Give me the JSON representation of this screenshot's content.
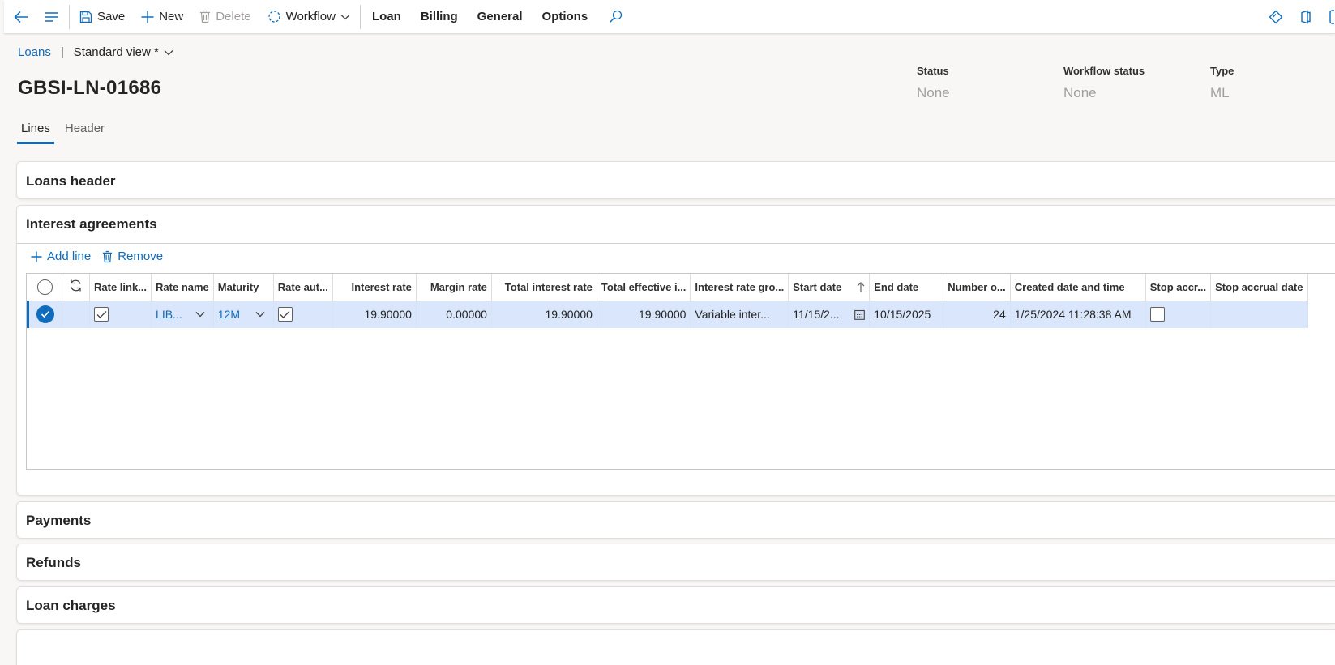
{
  "toolbar": {
    "save": "Save",
    "new": "New",
    "delete": "Delete",
    "workflow": "Workflow",
    "menus": [
      "Loan",
      "Billing",
      "General",
      "Options"
    ]
  },
  "breadcrumb": {
    "link": "Loans",
    "separator": "|",
    "view": "Standard view *"
  },
  "title": "GBSI-LN-01686",
  "summary": [
    {
      "label": "Status",
      "value": "None"
    },
    {
      "label": "Workflow status",
      "value": "None"
    },
    {
      "label": "Type",
      "value": "ML"
    }
  ],
  "tabs": [
    "Lines",
    "Header"
  ],
  "sections": {
    "loans_header": "Loans header",
    "interest_agreements": "Interest agreements",
    "payments": "Payments",
    "refunds": "Refunds",
    "loan_charges": "Loan charges"
  },
  "grid_actions": {
    "add_line": "Add line",
    "remove": "Remove"
  },
  "grid": {
    "columns": [
      "Rate link...",
      "Rate name",
      "Maturity",
      "Rate aut...",
      "Interest rate",
      "Margin rate",
      "Total interest rate",
      "Total effective i...",
      "Interest rate gro...",
      "Start date",
      "End date",
      "Number o...",
      "Created date and time",
      "Stop accr...",
      "Stop accrual date"
    ],
    "rows": [
      {
        "rate_linked": true,
        "rate_name": "LIB...",
        "maturity": "12M",
        "rate_auto": true,
        "interest_rate": "19.90000",
        "margin_rate": "0.00000",
        "total_interest_rate": "19.90000",
        "total_effective": "19.90000",
        "interest_rate_group": "Variable inter...",
        "start_date": "11/15/2...",
        "end_date": "10/15/2025",
        "number": "24",
        "created": "1/25/2024 11:28:38 AM",
        "stop_accrual": false,
        "stop_accrual_date": ""
      }
    ]
  }
}
